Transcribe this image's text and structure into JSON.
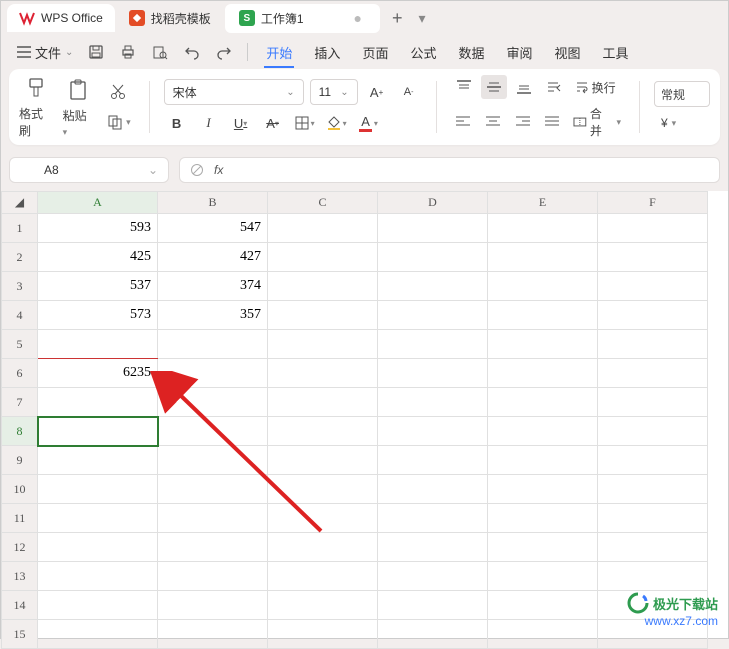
{
  "top_tabs": {
    "app_name": "WPS Office",
    "template_tab": "找稻壳模板",
    "workbook_tab": "工作簿1",
    "close_glyph": "●",
    "add_glyph": "+",
    "dropdown_glyph": "▾"
  },
  "menu": {
    "file": "文件",
    "items": [
      "开始",
      "插入",
      "页面",
      "公式",
      "数据",
      "审阅",
      "视图",
      "工具"
    ]
  },
  "ribbon": {
    "format_painter": "格式刷",
    "paste": "粘贴",
    "font_name": "宋体",
    "font_size": "11",
    "wrap": "换行",
    "merge": "合并",
    "general": "常规",
    "currency": "¥"
  },
  "name_box": {
    "value": "A8",
    "arrow": "⌄"
  },
  "formula_bar": {
    "fx": "fx"
  },
  "columns": [
    "A",
    "B",
    "C",
    "D",
    "E",
    "F"
  ],
  "rows": [
    "1",
    "2",
    "3",
    "4",
    "5",
    "6",
    "7",
    "8",
    "9",
    "10",
    "11",
    "12",
    "13",
    "14",
    "15"
  ],
  "cells": {
    "A1": "593",
    "B1": "547",
    "A2": "425",
    "B2": "427",
    "A3": "537",
    "B3": "374",
    "A4": "573",
    "B4": "357",
    "A6": "6235"
  },
  "selection": {
    "cell": "A8",
    "col": "A",
    "row": "8"
  },
  "watermark": {
    "line1": "极光下载站",
    "line2": "www.xz7.com"
  }
}
